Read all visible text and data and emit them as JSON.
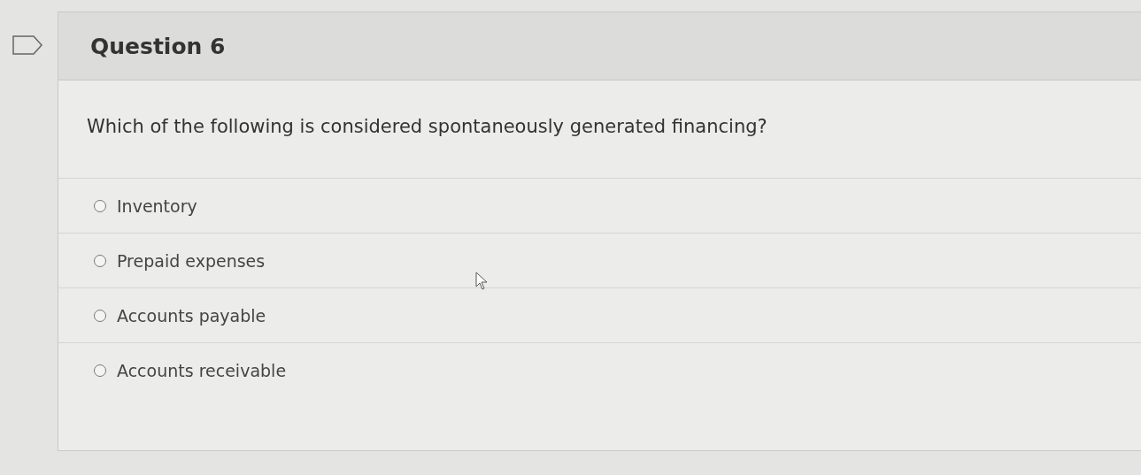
{
  "question": {
    "title": "Question 6",
    "flagged": false,
    "prompt": "Which of the following is considered spontaneously generated financing?",
    "options": [
      {
        "label": "Inventory",
        "selected": false
      },
      {
        "label": "Prepaid expenses",
        "selected": false
      },
      {
        "label": "Accounts payable",
        "selected": false
      },
      {
        "label": "Accounts receivable",
        "selected": false
      }
    ]
  }
}
